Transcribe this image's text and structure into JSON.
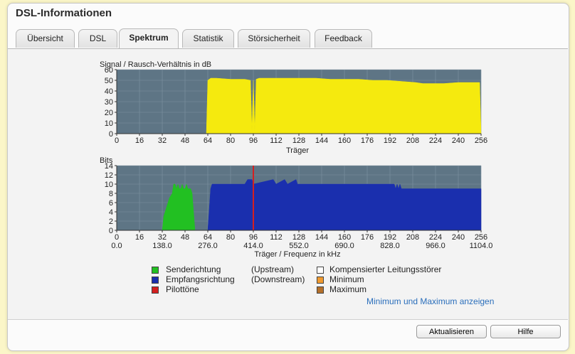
{
  "window": {
    "title": "DSL-Informationen"
  },
  "tabs": [
    {
      "label": "Übersicht"
    },
    {
      "label": "DSL"
    },
    {
      "label": "Spektrum",
      "active": true
    },
    {
      "label": "Statistik"
    },
    {
      "label": "Störsicherheit"
    },
    {
      "label": "Feedback"
    }
  ],
  "snr_chart": {
    "ylabel": "Signal / Rausch-Verhältnis in dB",
    "xlabel": "Träger",
    "yticks": [
      "0",
      "10",
      "20",
      "30",
      "40",
      "50",
      "60"
    ],
    "xticks": [
      "0",
      "16",
      "32",
      "48",
      "64",
      "80",
      "96",
      "112",
      "128",
      "144",
      "160",
      "176",
      "192",
      "208",
      "224",
      "240",
      "256"
    ]
  },
  "bits_chart": {
    "ylabel": "Bits",
    "xlabel": "Träger / Frequenz in kHz",
    "yticks": [
      "0",
      "2",
      "4",
      "6",
      "8",
      "10",
      "12",
      "14"
    ],
    "xticks": [
      "0",
      "16",
      "32",
      "48",
      "64",
      "80",
      "96",
      "112",
      "128",
      "144",
      "160",
      "176",
      "192",
      "208",
      "224",
      "240",
      "256"
    ],
    "freqticks": [
      "0.0",
      "138.0",
      "276.0",
      "414.0",
      "552.0",
      "690.0",
      "828.0",
      "966.0",
      "1104.0"
    ]
  },
  "legend": {
    "sender": {
      "label": "Senderichtung",
      "note": "(Upstream)",
      "color": "#22c022"
    },
    "empfang": {
      "label": "Empfangsrichtung",
      "note": "(Downstream)",
      "color": "#1a2fae"
    },
    "pilot": {
      "label": "Pilottöne",
      "color": "#d42020"
    },
    "kompensiert": {
      "label": "Kompensierter Leitungsstörer",
      "color": "#ffffff"
    },
    "minimum": {
      "label": "Minimum",
      "color": "#f09a30"
    },
    "maximum": {
      "label": "Maximum",
      "color": "#b4702a"
    }
  },
  "minmax_link": "Minimum und Maximum anzeigen",
  "buttons": {
    "refresh": "Aktualisieren",
    "help": "Hilfe"
  },
  "colors": {
    "plot_bg": "#5e7585",
    "snr_fill": "#f5ea0e",
    "upstream": "#22c022",
    "downstream": "#1a2fae",
    "pilot": "#d42020"
  },
  "chart_data": [
    {
      "type": "area",
      "title": "",
      "ylabel": "Signal / Rausch-Verhältnis in dB",
      "xlabel": "Träger",
      "xlim": [
        0,
        256
      ],
      "ylim": [
        0,
        60
      ],
      "grid": true,
      "series": [
        {
          "x": [
            63,
            64,
            66,
            70,
            80,
            90,
            94,
            95,
            96,
            97,
            98,
            100,
            110,
            120,
            130,
            140,
            150,
            160,
            170,
            180,
            190,
            200,
            210,
            215,
            220,
            230,
            240,
            250,
            255,
            256
          ],
          "values": [
            0,
            50,
            52,
            52,
            51,
            51,
            50,
            3,
            50,
            3,
            51,
            52,
            52,
            52,
            52,
            52,
            51,
            51,
            51,
            50,
            50,
            49,
            48,
            47,
            47,
            47,
            48,
            48,
            48,
            0
          ]
        }
      ]
    },
    {
      "type": "area",
      "title": "",
      "ylabel": "Bits",
      "xlabel": "Träger / Frequenz in kHz",
      "xlim": [
        0,
        256
      ],
      "ylim": [
        0,
        14
      ],
      "grid": true,
      "series": [
        {
          "name": "Senderichtung",
          "x": [
            32,
            33,
            35,
            37,
            39,
            40,
            41,
            42,
            43,
            44,
            45,
            46,
            47,
            48,
            49,
            50,
            51,
            52,
            53,
            54,
            55
          ],
          "values": [
            0,
            3,
            5,
            7,
            8,
            10,
            10,
            9,
            10,
            9,
            9,
            10,
            9,
            9,
            10,
            9,
            9,
            9,
            8,
            4,
            0
          ]
        },
        {
          "name": "Empfangsrichtung",
          "x": [
            64,
            66,
            67,
            90,
            92,
            95,
            96,
            110,
            112,
            118,
            120,
            126,
            127,
            150,
            195,
            196,
            197,
            198,
            199,
            200,
            201,
            202,
            256
          ],
          "values": [
            0,
            9,
            10,
            10,
            11,
            11,
            10,
            11,
            10,
            11,
            10,
            11,
            10,
            10,
            10,
            9,
            10,
            9,
            10,
            9,
            9,
            9,
            9
          ]
        },
        {
          "name": "Pilottöne",
          "x": [
            96
          ],
          "values": [
            14
          ]
        }
      ]
    }
  ]
}
